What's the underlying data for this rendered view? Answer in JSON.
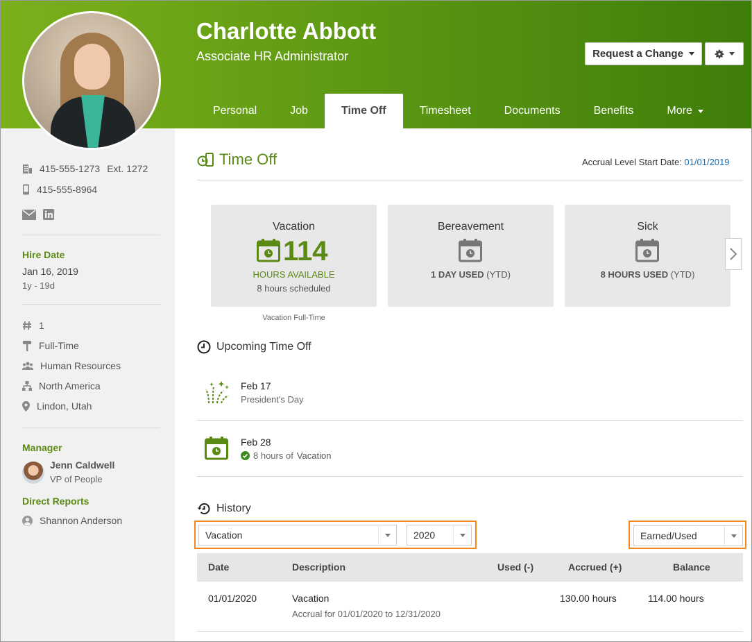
{
  "employee": {
    "name": "Charlotte Abbott",
    "title": "Associate HR Administrator"
  },
  "actions": {
    "request_change": "Request a Change"
  },
  "tabs": [
    {
      "label": "Personal"
    },
    {
      "label": "Job"
    },
    {
      "label": "Time Off"
    },
    {
      "label": "Timesheet"
    },
    {
      "label": "Documents"
    },
    {
      "label": "Benefits"
    },
    {
      "label": "More"
    }
  ],
  "active_tab": "Time Off",
  "sidebar": {
    "work_phone": "415-555-1273",
    "ext": "Ext. 1272",
    "mobile_phone": "415-555-8964",
    "hire_date_label": "Hire Date",
    "hire_date": "Jan 16, 2019",
    "tenure": "1y - 19d",
    "employee_number": "1",
    "employment_status": "Full-Time",
    "department": "Human Resources",
    "division": "North America",
    "location": "Lindon, Utah",
    "manager_label": "Manager",
    "manager_name": "Jenn Caldwell",
    "manager_title": "VP of People",
    "direct_reports_label": "Direct Reports",
    "direct_report": "Shannon Anderson"
  },
  "time_off": {
    "title": "Time Off",
    "accrual_label": "Accrual Level Start Date:",
    "accrual_date": "01/01/2019",
    "cards": [
      {
        "name": "Vacation",
        "value": "114",
        "value_label": "HOURS AVAILABLE",
        "scheduled": "8 hours scheduled",
        "caption": "Vacation Full-Time"
      },
      {
        "name": "Bereavement",
        "used_value": "1 DAY USED",
        "used_suffix": "(YTD)"
      },
      {
        "name": "Sick",
        "used_value": "8 HOURS USED",
        "used_suffix": "(YTD)"
      }
    ]
  },
  "upcoming": {
    "title": "Upcoming Time Off",
    "items": [
      {
        "date": "Feb 17",
        "desc": "President's Day",
        "icon": "fireworks-icon"
      },
      {
        "date": "Feb 28",
        "desc_pre": "8 hours of",
        "desc_type": "Vacation",
        "icon": "calendar-icon",
        "status": "approved"
      }
    ]
  },
  "history": {
    "title": "History",
    "type_select": "Vacation",
    "year_select": "2020",
    "view_select": "Earned/Used",
    "columns": [
      "Date",
      "Description",
      "Used (-)",
      "Accrued (+)",
      "Balance"
    ],
    "rows": [
      {
        "date": "01/01/2020",
        "desc": "Vacation",
        "sub": "Accrual for 01/01/2020 to 12/31/2020",
        "used": "",
        "accrued": "130.00 hours",
        "balance": "114.00 hours"
      }
    ]
  },
  "colors": {
    "brand_green": "#5a8a14",
    "highlight_orange": "#f08a1c",
    "link_blue": "#1a6fb5"
  }
}
